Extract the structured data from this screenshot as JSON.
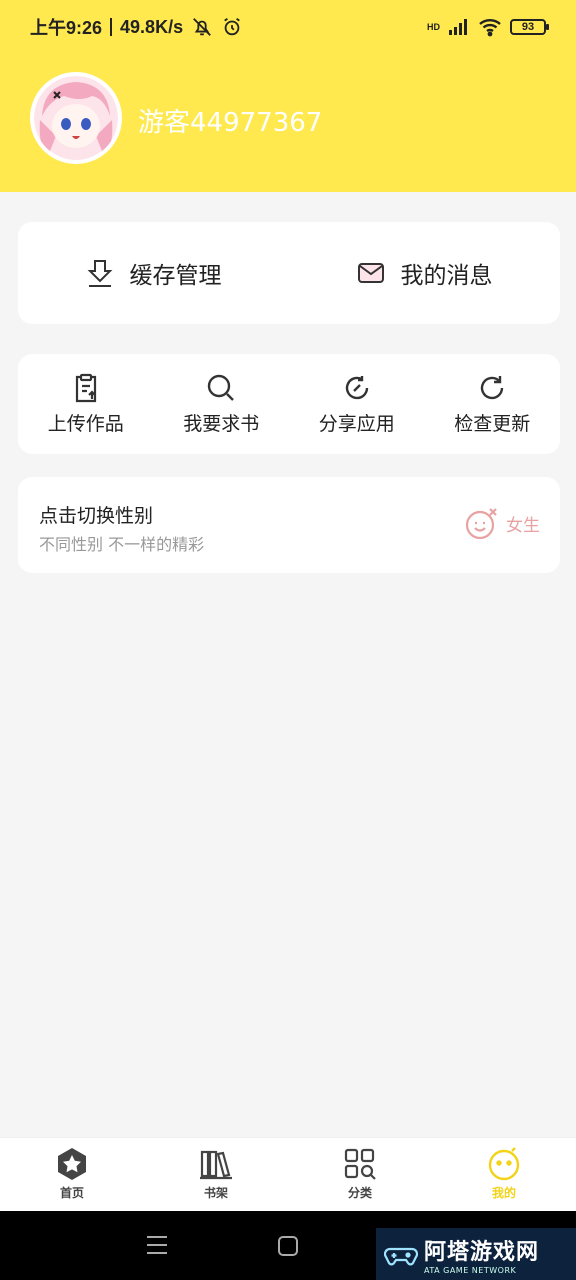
{
  "status_bar": {
    "time": "上午9:26",
    "net_speed": "49.8K/s",
    "hd_label": "HD",
    "battery": "93"
  },
  "profile": {
    "username": "游客44977367"
  },
  "quick_actions": {
    "cache": "缓存管理",
    "messages": "我的消息"
  },
  "tools": {
    "upload": "上传作品",
    "request_book": "我要求书",
    "share_app": "分享应用",
    "check_update": "检查更新"
  },
  "gender": {
    "title": "点击切换性别",
    "subtitle": "不同性别 不一样的精彩",
    "current": "女生"
  },
  "tabbar": {
    "home": "首页",
    "bookshelf": "书架",
    "category": "分类",
    "mine": "我的"
  },
  "watermark": {
    "title": "阿塔游戏网",
    "subtitle": "ATA GAME NETWORK"
  },
  "colors": {
    "accent": "#ffe94f",
    "active_tab": "#f2d318",
    "gender_pink": "#e8a2a2"
  }
}
